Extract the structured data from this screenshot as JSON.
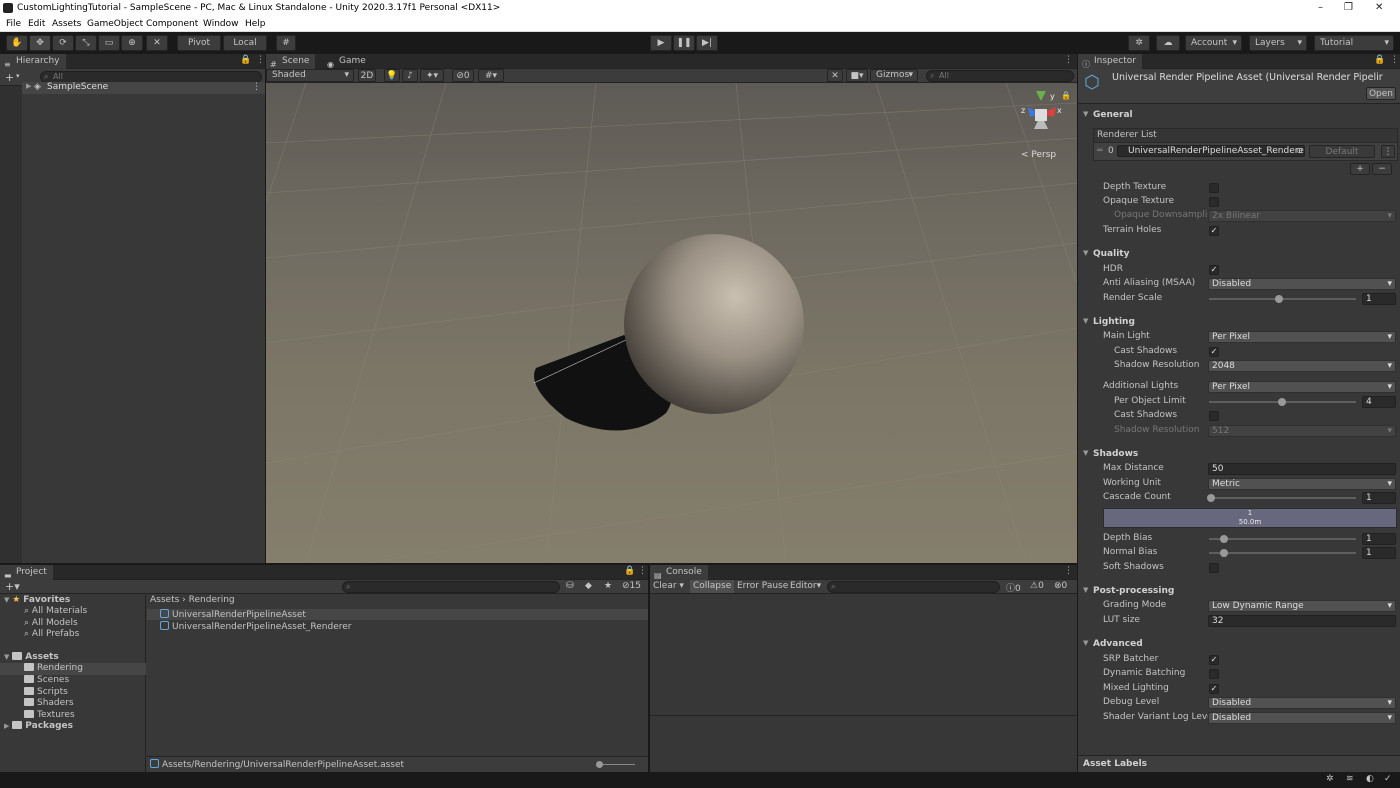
{
  "window": {
    "title": "CustomLightingTutorial - SampleScene - PC, Mac & Linux Standalone - Unity 2020.3.17f1 Personal <DX11>",
    "minimize": "–",
    "maximize": "❐",
    "close": "✕"
  },
  "menu": [
    "File",
    "Edit",
    "Assets",
    "GameObject",
    "Component",
    "Window",
    "Help"
  ],
  "toolbar": {
    "pivot": "Pivot",
    "local": "Local",
    "account": "Account",
    "layers": "Layers",
    "layout": "Tutorial"
  },
  "hierarchy": {
    "tab": "Hierarchy",
    "search_placeholder": "All",
    "scene": "SampleScene",
    "add": "+"
  },
  "scene": {
    "tab_scene": "Scene",
    "tab_game": "Game",
    "shading": "Shaded",
    "mode_2d": "2D",
    "hidden_count": "0",
    "gizmos": "Gizmos",
    "search_placeholder": "All",
    "persp": "< Persp",
    "axis_x": "x",
    "axis_y": "y",
    "axis_z": "z"
  },
  "inspector": {
    "tab": "Inspector",
    "asset_title": "Universal Render Pipeline Asset (Universal Render Pipelir",
    "open": "Open",
    "general": {
      "title": "General",
      "renderer_list": "Renderer List",
      "renderer_index": "0",
      "renderer_name": "UniversalRenderPipelineAsset_Rendere",
      "renderer_default": "Default",
      "depth_texture": "Depth Texture",
      "opaque_texture": "Opaque Texture",
      "opaque_downsampling": "Opaque Downsampling",
      "opaque_downsampling_value": "2x Bilinear",
      "terrain_holes": "Terrain Holes"
    },
    "quality": {
      "title": "Quality",
      "hdr": "HDR",
      "msaa": "Anti Aliasing (MSAA)",
      "msaa_value": "Disabled",
      "render_scale": "Render Scale",
      "render_scale_value": "1"
    },
    "lighting": {
      "title": "Lighting",
      "main_light": "Main Light",
      "main_light_value": "Per Pixel",
      "cast_shadows": "Cast Shadows",
      "shadow_resolution": "Shadow Resolution",
      "shadow_resolution_value": "2048",
      "additional_lights": "Additional Lights",
      "additional_lights_value": "Per Pixel",
      "per_object_limit": "Per Object Limit",
      "per_object_limit_value": "4",
      "add_cast_shadows": "Cast Shadows",
      "add_shadow_resolution": "Shadow Resolution",
      "add_shadow_resolution_value": "512"
    },
    "shadows": {
      "title": "Shadows",
      "max_distance": "Max Distance",
      "max_distance_value": "50",
      "working_unit": "Working Unit",
      "working_unit_value": "Metric",
      "cascade_count": "Cascade Count",
      "cascade_count_value": "1",
      "cascade_bar_index": "1",
      "cascade_bar_dist": "50.0m",
      "depth_bias": "Depth Bias",
      "depth_bias_value": "1",
      "normal_bias": "Normal Bias",
      "normal_bias_value": "1",
      "soft_shadows": "Soft Shadows"
    },
    "post": {
      "title": "Post-processing",
      "grading_mode": "Grading Mode",
      "grading_mode_value": "Low Dynamic Range",
      "lut_size": "LUT size",
      "lut_size_value": "32"
    },
    "advanced": {
      "title": "Advanced",
      "srp_batcher": "SRP Batcher",
      "dynamic_batching": "Dynamic Batching",
      "mixed_lighting": "Mixed Lighting",
      "debug_level": "Debug Level",
      "debug_level_value": "Disabled",
      "shader_variant": "Shader Variant Log Level",
      "shader_variant_value": "Disabled"
    },
    "asset_labels": "Asset Labels"
  },
  "project": {
    "tab": "Project",
    "favorites": "Favorites",
    "all_materials": "All Materials",
    "all_models": "All Models",
    "all_prefabs": "All Prefabs",
    "assets": "Assets",
    "rendering": "Rendering",
    "scenes": "Scenes",
    "scripts": "Scripts",
    "shaders": "Shaders",
    "textures": "Textures",
    "packages": "Packages",
    "breadcrumb_root": "Assets",
    "breadcrumb_sep": "›",
    "breadcrumb_current": "Rendering",
    "file1": "UniversalRenderPipelineAsset",
    "file2": "UniversalRenderPipelineAsset_Renderer",
    "path": "Assets/Rendering/UniversalRenderPipelineAsset.asset",
    "hidden_count": "15"
  },
  "console": {
    "tab": "Console",
    "clear": "Clear",
    "collapse": "Collapse",
    "error_pause": "Error Pause",
    "editor": "Editor",
    "info_count": "0",
    "warn_count": "0",
    "err_count": "0"
  }
}
